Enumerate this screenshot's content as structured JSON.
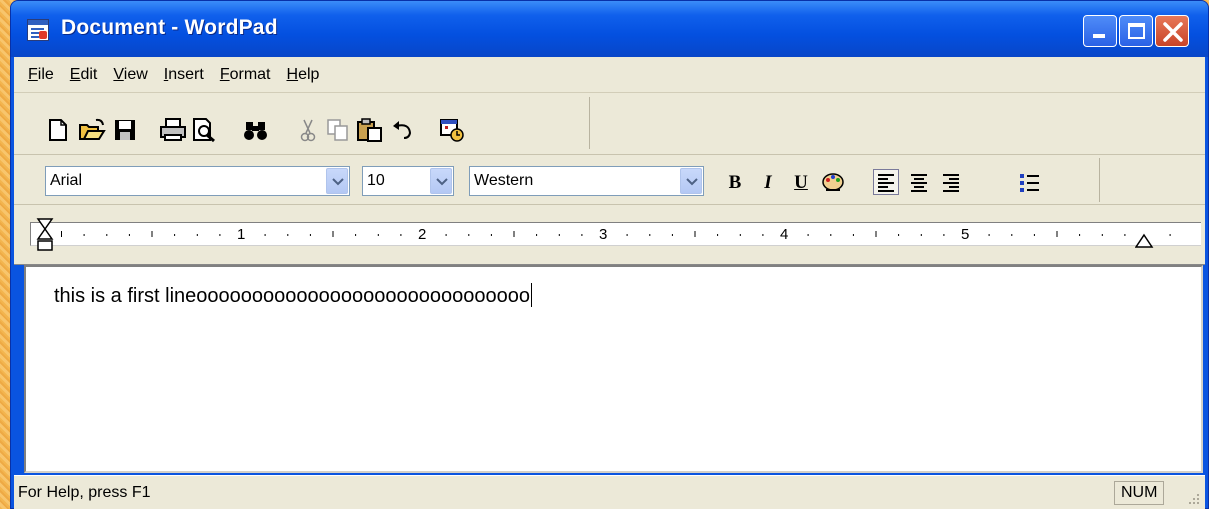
{
  "window": {
    "title": "Document - WordPad"
  },
  "menubar": {
    "items": [
      {
        "label": "File"
      },
      {
        "label": "Edit"
      },
      {
        "label": "View"
      },
      {
        "label": "Insert"
      },
      {
        "label": "Format"
      },
      {
        "label": "Help"
      }
    ]
  },
  "toolbar": {
    "icons": [
      "new-icon",
      "open-icon",
      "save-icon",
      "print-icon",
      "print-preview-icon",
      "find-icon",
      "cut-icon",
      "copy-icon",
      "paste-icon",
      "undo-icon",
      "date-time-icon"
    ]
  },
  "format_bar": {
    "font": "Arial",
    "size": "10",
    "script": "Western",
    "bold_label": "B",
    "italic_label": "I",
    "underline_label": "U"
  },
  "ruler": {
    "numbers": [
      "1",
      "2",
      "3",
      "4",
      "5"
    ]
  },
  "document": {
    "text": "this is a first lineoooooooooooooooooooooooooooooo"
  },
  "statusbar": {
    "help_text": "For Help, press F1",
    "num_indicator": "NUM"
  },
  "colors": {
    "titlebar": "#0450e0",
    "chrome": "#ece9d8",
    "close": "#c84428"
  }
}
